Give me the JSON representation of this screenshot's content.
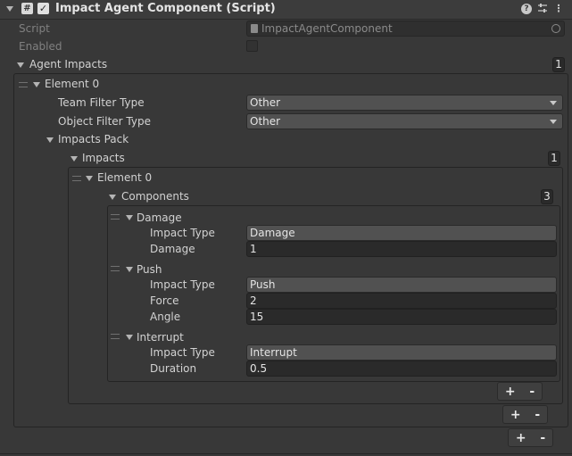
{
  "header": {
    "title": "Impact Agent Component (Script)",
    "menu_glyph": "⋮"
  },
  "script_row": {
    "label": "Script",
    "value": "ImpactAgentComponent"
  },
  "enabled_row": {
    "label": "Enabled"
  },
  "agent_impacts": {
    "label": "Agent Impacts",
    "count": "1",
    "element0": {
      "label": "Element 0",
      "team_filter": {
        "label": "Team Filter Type",
        "value": "Other"
      },
      "object_filter": {
        "label": "Object Filter Type",
        "value": "Other"
      },
      "impacts_pack": {
        "label": "Impacts Pack",
        "impacts": {
          "label": "Impacts",
          "count": "1",
          "element0": {
            "label": "Element 0",
            "components": {
              "label": "Components",
              "count": "3",
              "damage": {
                "label": "Damage",
                "impact_type_label": "Impact Type",
                "impact_type_value": "Damage",
                "damage_label": "Damage",
                "damage_value": "1"
              },
              "push": {
                "label": "Push",
                "impact_type_label": "Impact Type",
                "impact_type_value": "Push",
                "force_label": "Force",
                "force_value": "2",
                "angle_label": "Angle",
                "angle_value": "15"
              },
              "interrupt": {
                "label": "Interrupt",
                "impact_type_label": "Impact Type",
                "impact_type_value": "Interrupt",
                "duration_label": "Duration",
                "duration_value": "0.5"
              }
            }
          }
        }
      }
    }
  },
  "list_buttons": {
    "plus": "+",
    "minus": "-"
  },
  "colors": {
    "background": "#383838",
    "header": "#3c3c3c",
    "field": "#2a2a2a",
    "dropdown": "#515151"
  }
}
